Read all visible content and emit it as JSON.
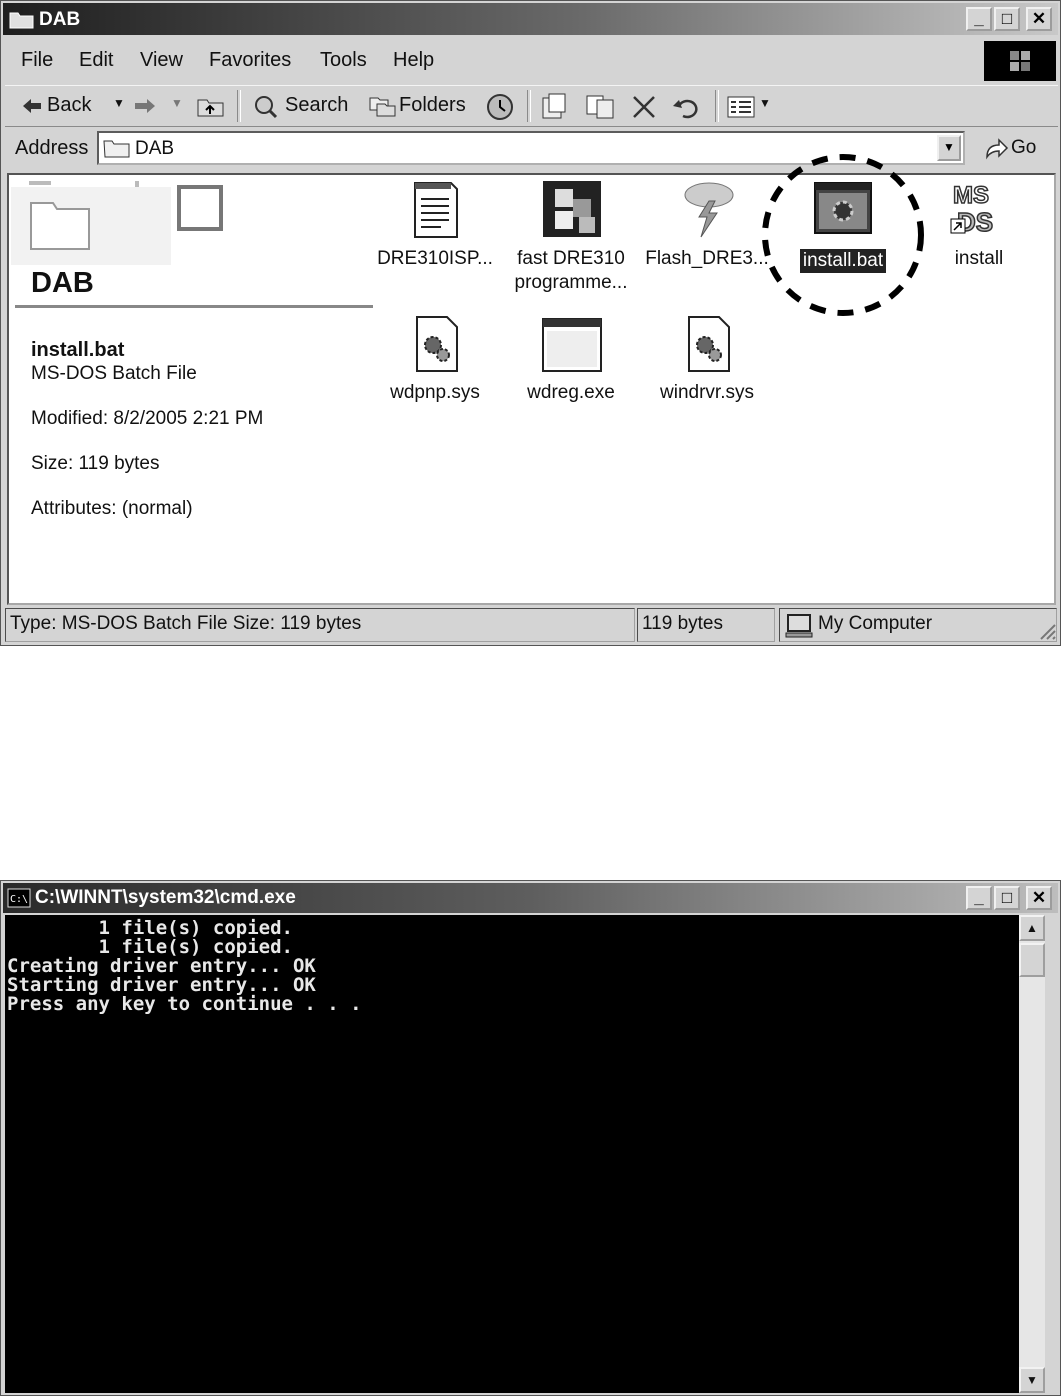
{
  "explorer": {
    "title": "DAB",
    "menu": [
      "File",
      "Edit",
      "View",
      "Favorites",
      "Tools",
      "Help"
    ],
    "toolbar": {
      "back": "Back",
      "search": "Search",
      "folders": "Folders"
    },
    "address": {
      "label": "Address",
      "value": "DAB",
      "go": "Go"
    },
    "sidepanel": {
      "folder_name": "DAB",
      "selected_name": "install.bat",
      "selected_type": "MS-DOS Batch File",
      "modified": "Modified: 8/2/2005 2:21 PM",
      "size": "Size: 119 bytes",
      "attributes": "Attributes: (normal)"
    },
    "files": [
      {
        "name": "DRE310ISP...",
        "line2": "",
        "icon": "document-icon"
      },
      {
        "name": "fast DRE310",
        "line2": "programme...",
        "icon": "program-icon"
      },
      {
        "name": "Flash_DRE3...",
        "line2": "",
        "icon": "flash-icon"
      },
      {
        "name": "install.bat",
        "line2": "",
        "icon": "batch-file-icon",
        "selected": true
      },
      {
        "name": "install",
        "line2": "",
        "icon": "msdos-shortcut-icon"
      },
      {
        "name": "wdpnp.sys",
        "line2": "",
        "icon": "system-file-icon"
      },
      {
        "name": "wdreg.exe",
        "line2": "",
        "icon": "exe-window-icon"
      },
      {
        "name": "windrvr.sys",
        "line2": "",
        "icon": "system-file-icon"
      }
    ],
    "status": {
      "main": "Type: MS-DOS Batch File Size: 119 bytes",
      "size": "119 bytes",
      "zone": "My Computer"
    }
  },
  "cmd": {
    "title": "C:\\WINNT\\system32\\cmd.exe",
    "lines": [
      "        1 file(s) copied.",
      "        1 file(s) copied.",
      "Creating driver entry... OK",
      "Starting driver entry... OK",
      "Press any key to continue . . ."
    ]
  },
  "colors": {
    "titlebar_dark": "#1e1e1e",
    "chrome": "#d4d4d4",
    "console_bg": "#000000",
    "console_text": "#e8e8e8"
  }
}
